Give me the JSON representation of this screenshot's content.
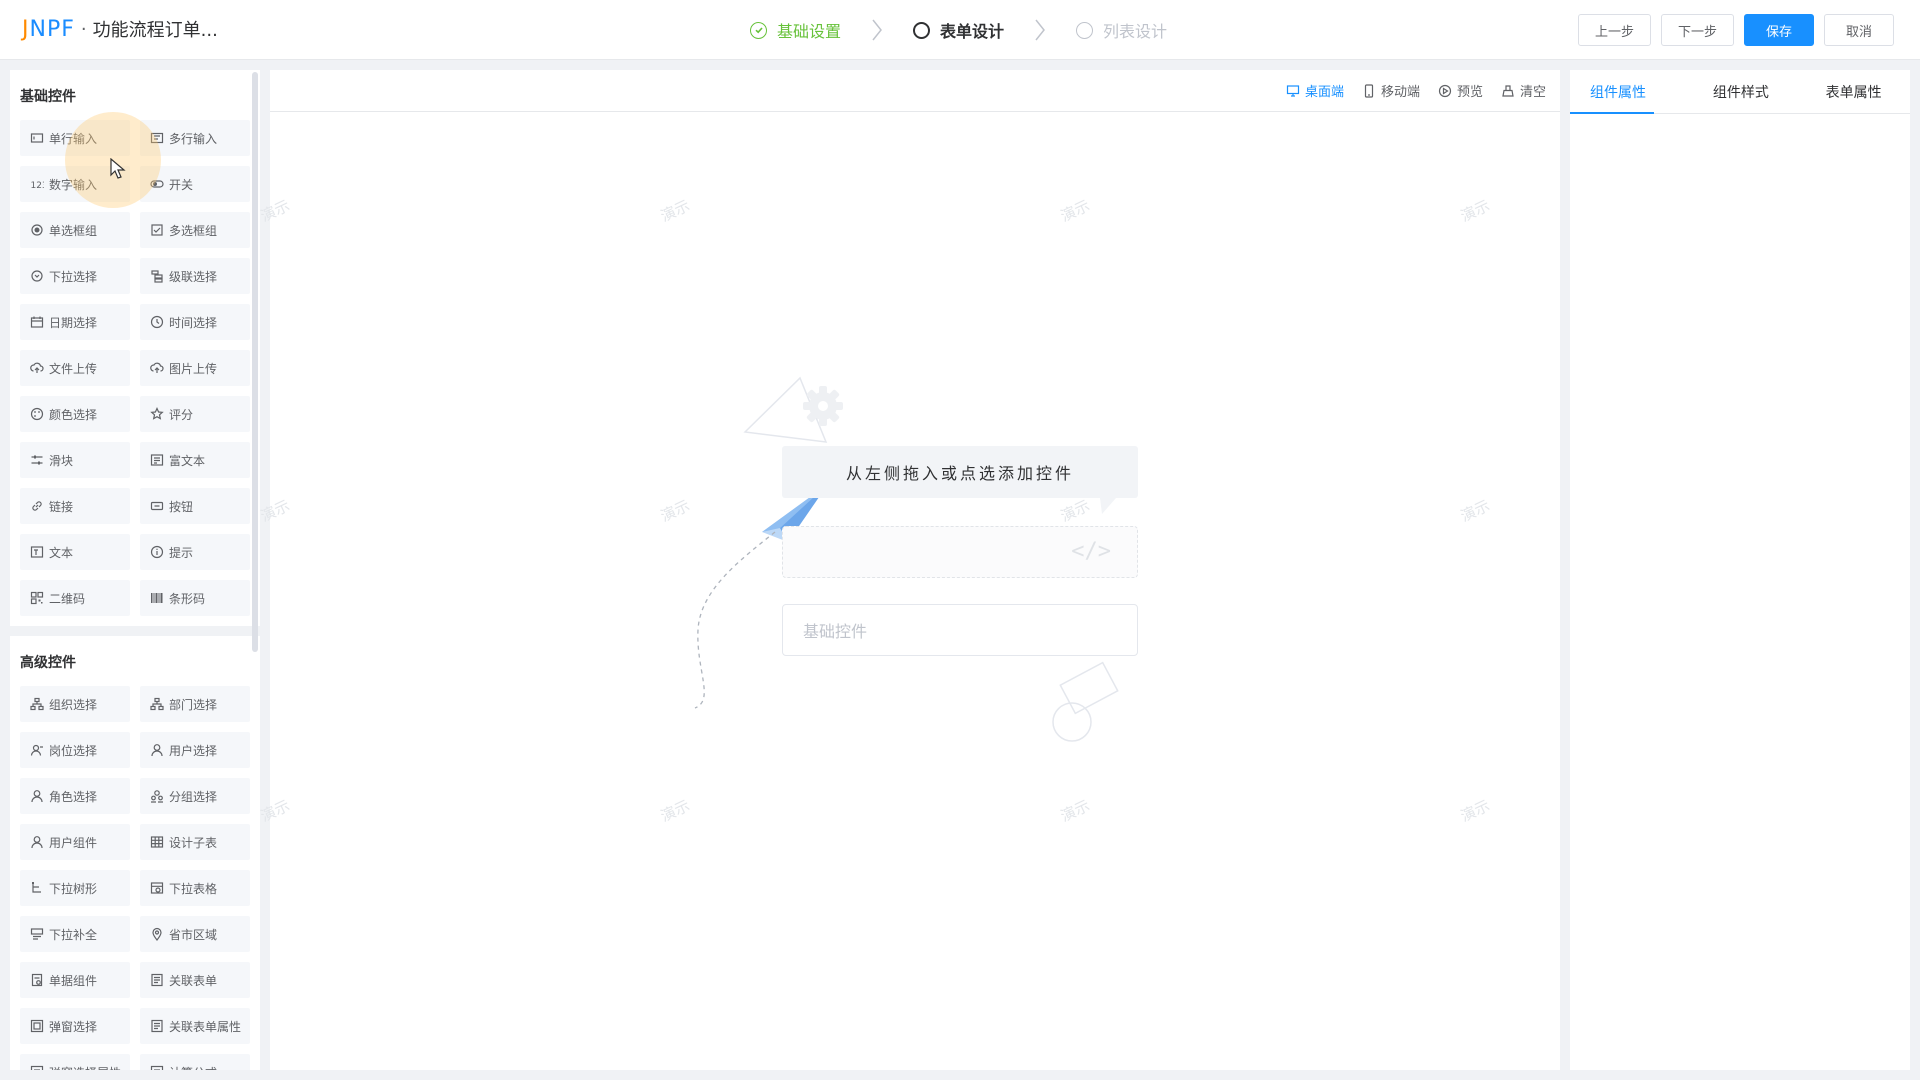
{
  "header": {
    "logo": "JNPF",
    "separator": "·",
    "title": "功能流程订单...",
    "steps": [
      {
        "label": "基础设置",
        "state": "done"
      },
      {
        "label": "表单设计",
        "state": "active"
      },
      {
        "label": "列表设计",
        "state": "todo"
      }
    ],
    "buttons": {
      "prev": "上一步",
      "next": "下一步",
      "save": "保存",
      "cancel": "取消"
    }
  },
  "left": {
    "basic_title": "基础控件",
    "basic_items": [
      {
        "label": "单行输入",
        "icon": "input-icon"
      },
      {
        "label": "多行输入",
        "icon": "textarea-icon"
      },
      {
        "label": "数字输入",
        "icon": "number-icon"
      },
      {
        "label": "开关",
        "icon": "switch-icon"
      },
      {
        "label": "单选框组",
        "icon": "radio-icon"
      },
      {
        "label": "多选框组",
        "icon": "checkbox-icon"
      },
      {
        "label": "下拉选择",
        "icon": "select-icon"
      },
      {
        "label": "级联选择",
        "icon": "cascader-icon"
      },
      {
        "label": "日期选择",
        "icon": "calendar-icon"
      },
      {
        "label": "时间选择",
        "icon": "clock-icon"
      },
      {
        "label": "文件上传",
        "icon": "upload-icon"
      },
      {
        "label": "图片上传",
        "icon": "image-upload-icon"
      },
      {
        "label": "颜色选择",
        "icon": "palette-icon"
      },
      {
        "label": "评分",
        "icon": "star-icon"
      },
      {
        "label": "滑块",
        "icon": "slider-icon"
      },
      {
        "label": "富文本",
        "icon": "richtext-icon"
      },
      {
        "label": "链接",
        "icon": "link-icon"
      },
      {
        "label": "按钮",
        "icon": "button-icon"
      },
      {
        "label": "文本",
        "icon": "text-icon"
      },
      {
        "label": "提示",
        "icon": "info-icon"
      },
      {
        "label": "二维码",
        "icon": "qrcode-icon"
      },
      {
        "label": "条形码",
        "icon": "barcode-icon"
      }
    ],
    "advanced_title": "高级控件",
    "advanced_items": [
      {
        "label": "组织选择",
        "icon": "org-icon"
      },
      {
        "label": "部门选择",
        "icon": "department-icon"
      },
      {
        "label": "岗位选择",
        "icon": "position-icon"
      },
      {
        "label": "用户选择",
        "icon": "user-icon"
      },
      {
        "label": "角色选择",
        "icon": "role-icon"
      },
      {
        "label": "分组选择",
        "icon": "group-icon"
      },
      {
        "label": "用户组件",
        "icon": "user-component-icon"
      },
      {
        "label": "设计子表",
        "icon": "table-icon"
      },
      {
        "label": "下拉树形",
        "icon": "tree-icon"
      },
      {
        "label": "下拉表格",
        "icon": "dropdown-table-icon"
      },
      {
        "label": "下拉补全",
        "icon": "autocomplete-icon"
      },
      {
        "label": "省市区域",
        "icon": "region-icon"
      },
      {
        "label": "单据组件",
        "icon": "document-icon"
      },
      {
        "label": "关联表单",
        "icon": "relation-form-icon"
      },
      {
        "label": "弹窗选择",
        "icon": "popup-icon"
      },
      {
        "label": "关联表单属性",
        "icon": "relation-attr-icon"
      },
      {
        "label": "弹窗选择属性",
        "icon": "popup-attr-icon"
      },
      {
        "label": "计算公式",
        "icon": "formula-icon"
      }
    ]
  },
  "canvas": {
    "tools": [
      {
        "label": "桌面端",
        "icon": "desktop-icon",
        "active": true
      },
      {
        "label": "移动端",
        "icon": "mobile-icon",
        "active": false
      },
      {
        "label": "预览",
        "icon": "preview-icon",
        "active": false
      },
      {
        "label": "清空",
        "icon": "clear-icon",
        "active": false
      }
    ],
    "empty_hint": "从左侧拖入或点选添加控件",
    "placeholder": "基础控件",
    "code_glyph": "</>",
    "watermark": "演示"
  },
  "right": {
    "tabs": [
      {
        "label": "组件属性",
        "active": true
      },
      {
        "label": "组件样式",
        "active": false
      },
      {
        "label": "表单属性",
        "active": false
      }
    ]
  },
  "colors": {
    "primary": "#1890ff",
    "success": "#67c23a",
    "logo_j": "#ff8a00"
  }
}
